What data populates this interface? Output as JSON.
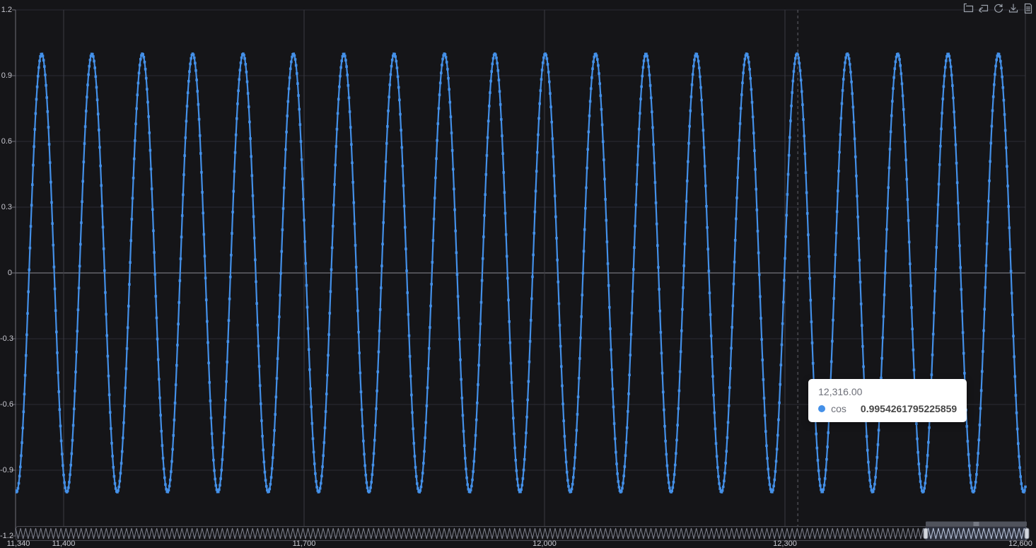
{
  "ui": {
    "colors": {
      "background": "#151518",
      "line": "#4490e8",
      "grid_horizontal": "#2c2c33",
      "grid_vertical": "#3a3a42",
      "zero_line": "#8a8a92",
      "axis": "#6e6e78",
      "label": "#c8c8d0",
      "crosshair": "#62626a",
      "tooltip_bg": "#ffffff",
      "tooltip_text": "#6e7079",
      "tooltip_value": "#464646",
      "slider_border": "#4a4a52",
      "slider_wave": "#80838f",
      "slider_wave_active": "#c2cbdc",
      "slider_window_fill": "rgba(130,150,195,0.22)",
      "slider_handle_fill": "#d4d7de",
      "slider_handle_stroke": "#777c88",
      "slider_move_bar": "#50535c",
      "slider_move_grip": "#9ba0ab",
      "icon": "#9aa0aa"
    },
    "toolbar": {
      "icons": [
        {
          "name": "zoom-select"
        },
        {
          "name": "zoom-reset"
        },
        {
          "name": "restore"
        },
        {
          "name": "save-image"
        },
        {
          "name": "data-view"
        }
      ]
    }
  },
  "chart_data": {
    "type": "line",
    "title": "",
    "series": [
      {
        "name": "cos",
        "color": "#4490e8",
        "function": "y = cos(x/10)",
        "omega": 0.1,
        "x_min": 11340,
        "x_max": 12600,
        "x_step": 1,
        "symbol": "square",
        "highlighted_point": {
          "x": 12316,
          "y": 0.9954261795225859
        }
      }
    ],
    "xlabel": "",
    "ylabel": "",
    "xlim": [
      11340,
      12600
    ],
    "ylim": [
      -1.2,
      1.2
    ],
    "x_ticks": {
      "values": [
        11340,
        11400,
        11700,
        12000,
        12300,
        12600
      ],
      "labels": [
        "11,340",
        "11,400",
        "11,700",
        "12,000",
        "12,300",
        "12,600"
      ]
    },
    "y_ticks": {
      "values": [
        1.2,
        0.9,
        0.6,
        0.3,
        0,
        -0.3,
        -0.6,
        -0.9,
        -1.2
      ],
      "labels": [
        "1.2",
        "0.9",
        "0.6",
        "0.3",
        "0",
        "-0.3",
        "-0.6",
        "-0.9",
        "-1.2"
      ]
    },
    "grid": true,
    "legend": {
      "show": false
    },
    "tooltip": {
      "x_value": 12316,
      "x_label": "12,316.00",
      "series": "cos",
      "value": "0.9954261795225859"
    },
    "datazoom": {
      "full_range": [
        0,
        12600
      ],
      "window": [
        11340,
        12600
      ]
    }
  }
}
